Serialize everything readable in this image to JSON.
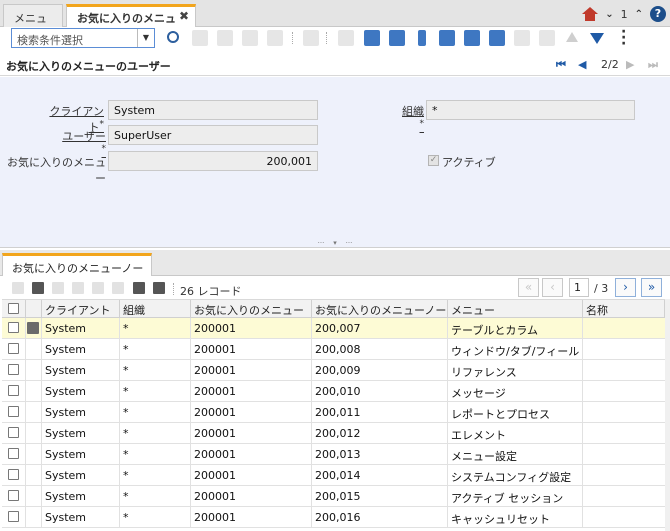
{
  "tabs": [
    {
      "label": "メニュー"
    },
    {
      "label": "お気に入りのメニュー",
      "close": "✖"
    }
  ],
  "topbar": {
    "count": "1",
    "help": "?"
  },
  "toolbar": {
    "search_placeholder": "検索条件選択"
  },
  "header": {
    "title": "お気に入りのメニューのユーザー",
    "record_position": "2/2"
  },
  "form": {
    "client_label": "クライアント",
    "client_value": "System",
    "org_label": "組織",
    "org_value": "*",
    "user_label": "ユーザー",
    "user_value": "SuperUser",
    "menu_label": "お気に入りのメニュー",
    "menu_value": "200,001",
    "active_label": "アクティブ",
    "active_checked": true
  },
  "detail": {
    "tab_label": "お気に入りのメニューノード",
    "record_count": "26 レコード",
    "page_current": "1",
    "page_total": "/ 3",
    "columns": [
      "クライアント",
      "組織",
      "お気に入りのメニュー",
      "お気に入りのメニューノード",
      "メニュー",
      "名称"
    ],
    "rows": [
      {
        "client": "System",
        "org": "*",
        "menu": "200001",
        "node": "200,007",
        "menu_item": "テーブルとカラム",
        "name": ""
      },
      {
        "client": "System",
        "org": "*",
        "menu": "200001",
        "node": "200,008",
        "menu_item": "ウィンドウ/タブ/フィールド",
        "name": ""
      },
      {
        "client": "System",
        "org": "*",
        "menu": "200001",
        "node": "200,009",
        "menu_item": "リファレンス",
        "name": ""
      },
      {
        "client": "System",
        "org": "*",
        "menu": "200001",
        "node": "200,010",
        "menu_item": "メッセージ",
        "name": ""
      },
      {
        "client": "System",
        "org": "*",
        "menu": "200001",
        "node": "200,011",
        "menu_item": "レポートとプロセス",
        "name": ""
      },
      {
        "client": "System",
        "org": "*",
        "menu": "200001",
        "node": "200,012",
        "menu_item": "エレメント",
        "name": ""
      },
      {
        "client": "System",
        "org": "*",
        "menu": "200001",
        "node": "200,013",
        "menu_item": "メニュー設定",
        "name": ""
      },
      {
        "client": "System",
        "org": "*",
        "menu": "200001",
        "node": "200,014",
        "menu_item": "システムコンフィグ設定",
        "name": ""
      },
      {
        "client": "System",
        "org": "*",
        "menu": "200001",
        "node": "200,015",
        "menu_item": "アクティブ セッション",
        "name": ""
      },
      {
        "client": "System",
        "org": "*",
        "menu": "200001",
        "node": "200,016",
        "menu_item": "キャッシュリセット",
        "name": ""
      }
    ]
  },
  "colors": {
    "accent": "#f2a51c",
    "form_bg": "#eef1fb",
    "selected_row": "#fdfbd5",
    "nav_blue": "#1f5aa6"
  }
}
